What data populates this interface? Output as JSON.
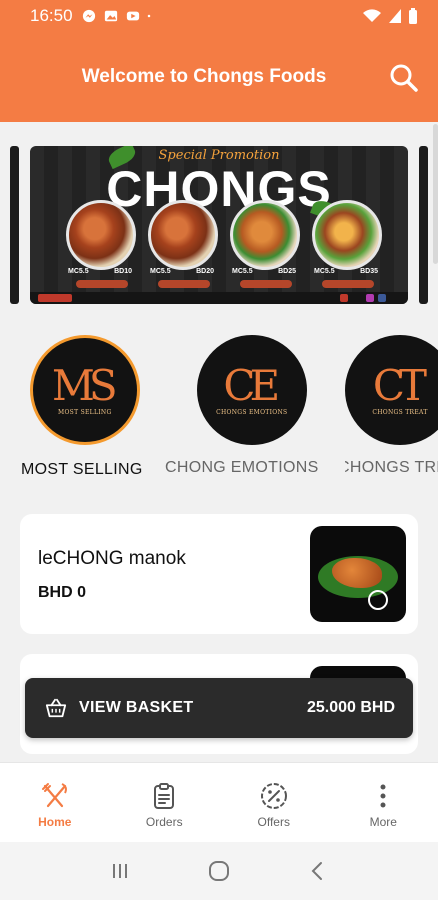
{
  "status_bar": {
    "time": "16:50",
    "left_icons": [
      "messenger-icon",
      "gallery-icon",
      "youtube-icon",
      "dot-icon"
    ],
    "right_icons": [
      "wifi-icon",
      "signal-icon",
      "battery-icon"
    ]
  },
  "app_bar": {
    "title": "Welcome to Chongs Foods",
    "search_icon": "search-icon",
    "bg_color": "#f47c44"
  },
  "banner": {
    "promo_text": "Special Promotion",
    "brand_text": "CHONGS",
    "dishes": [
      {
        "name": "MC5.5",
        "price": "BD10"
      },
      {
        "name": "MC5.5",
        "price": "BD20"
      },
      {
        "name": "MC5.5",
        "price": "BD25"
      },
      {
        "name": "MC5.5",
        "price": "BD35"
      }
    ]
  },
  "categories": [
    {
      "monogram": "MS",
      "sub": "MOST SELLING",
      "label": "MOST SELLING",
      "selected": true
    },
    {
      "monogram": "CE",
      "sub": "CHONGS EMOTIONS",
      "label": "CHONG EMOTIONS",
      "selected": false
    },
    {
      "monogram": "CT",
      "sub": "CHONGS TREAT",
      "label": "CHONGS TRE",
      "selected": false
    }
  ],
  "products": [
    {
      "name": "leCHONG manok",
      "price": "BHD 0"
    }
  ],
  "basket": {
    "label": "VIEW BASKET",
    "total": "25.000 BHD",
    "icon": "basket-icon"
  },
  "bottom_nav": {
    "items": [
      {
        "label": "Home",
        "icon": "utensils-icon",
        "active": true
      },
      {
        "label": "Orders",
        "icon": "clipboard-icon",
        "active": false
      },
      {
        "label": "Offers",
        "icon": "discount-icon",
        "active": false
      },
      {
        "label": "More",
        "icon": "more-vertical-icon",
        "active": false
      }
    ],
    "accent": "#f47c44"
  },
  "system_nav": [
    "recents-icon",
    "home-circle-icon",
    "back-icon"
  ]
}
